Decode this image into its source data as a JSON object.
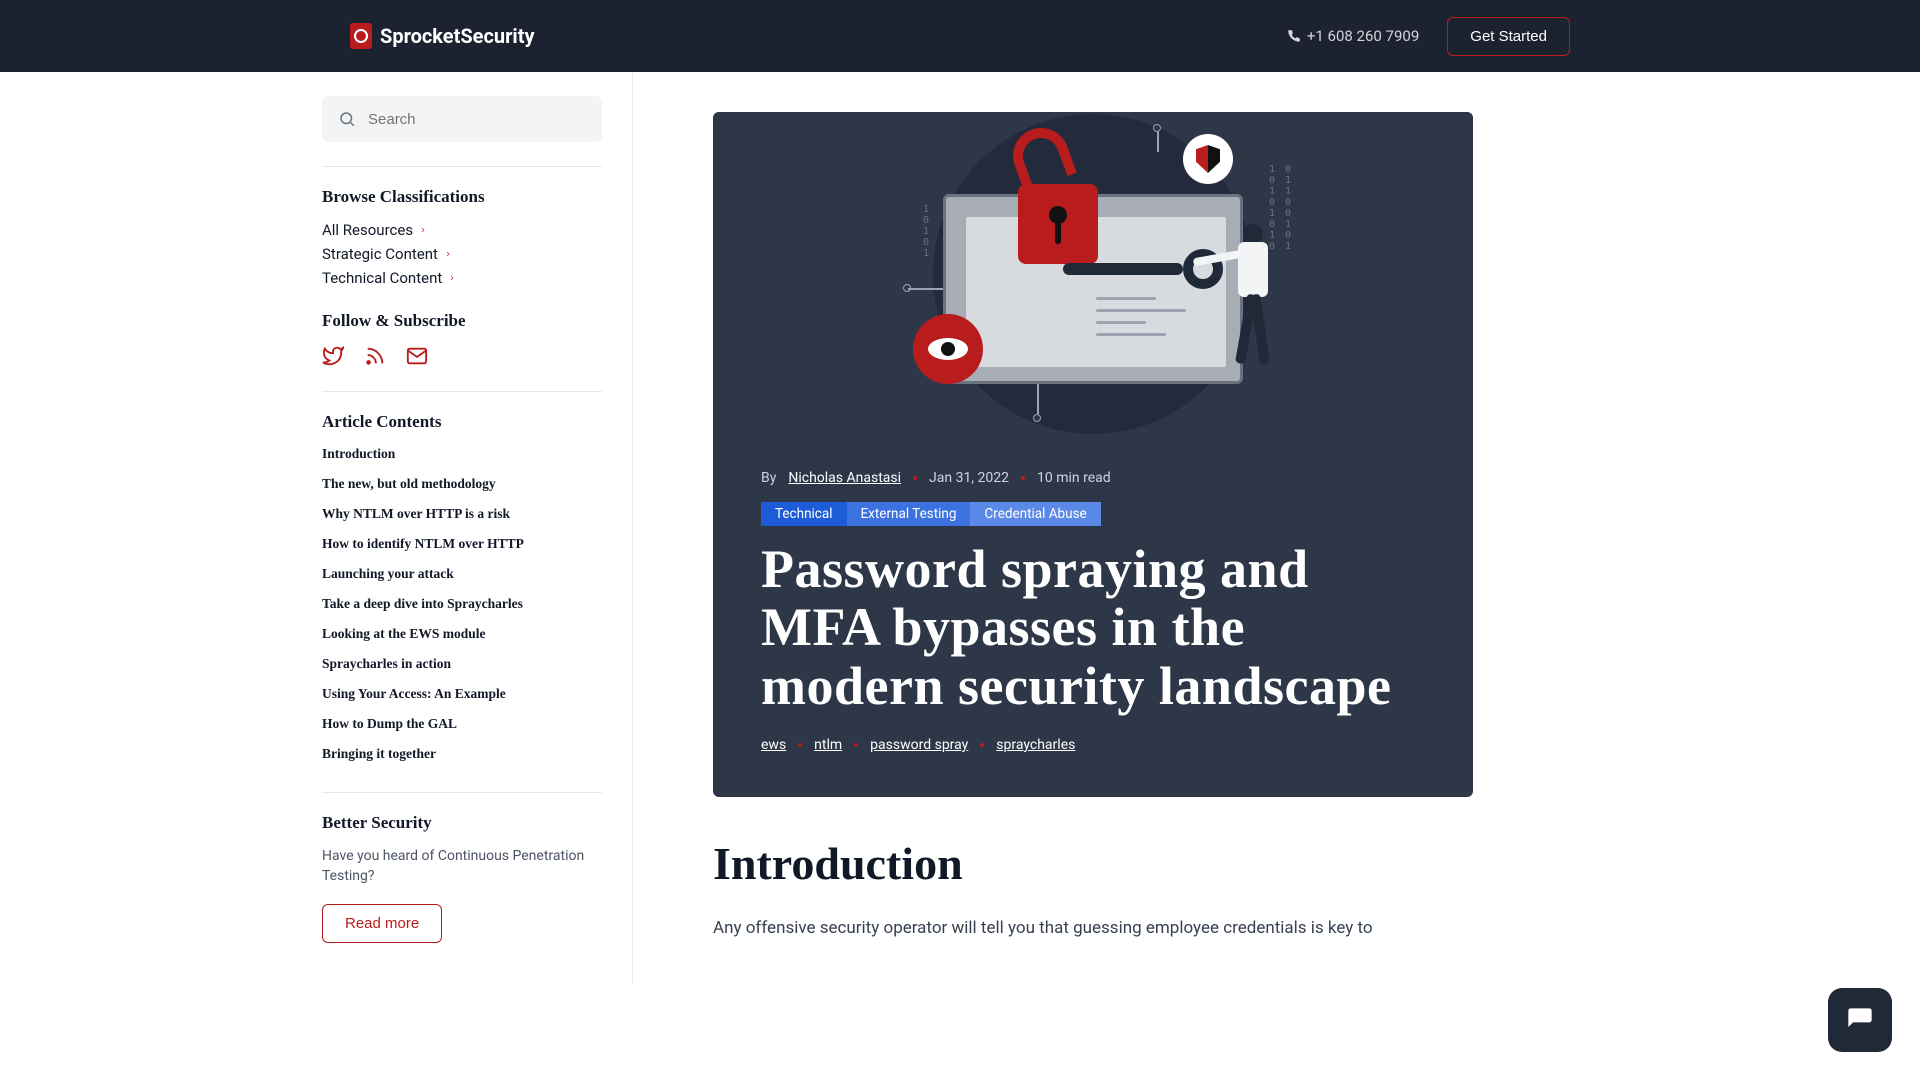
{
  "header": {
    "brand": "SprocketSecurity",
    "phone": "+1 608 260 7909",
    "cta": "Get Started"
  },
  "sidebar": {
    "search_placeholder": "Search",
    "browse_heading": "Browse Classifications",
    "classifications": [
      "All Resources",
      "Strategic Content",
      "Technical Content"
    ],
    "follow_heading": "Follow & Subscribe",
    "toc_heading": "Article Contents",
    "toc": [
      "Introduction",
      "The new, but old methodology",
      "Why NTLM over HTTP is a risk",
      "How to identify NTLM over HTTP",
      "Launching your attack",
      "Take a deep dive into Spraycharles",
      "Looking at the EWS module",
      "Spraycharles in action",
      "Using Your Access: An Example",
      "How to Dump the GAL",
      "Bringing it together"
    ],
    "better_heading": "Better Security",
    "better_text": "Have you heard of Continuous Penetration Testing?",
    "read_more": "Read more"
  },
  "article": {
    "by_label": "By",
    "author": "Nicholas Anastasi",
    "date": "Jan 31, 2022",
    "read_time": "10 min read",
    "categories": [
      "Technical",
      "External Testing",
      "Credential Abuse"
    ],
    "title": "Password spraying and MFA bypasses in the modern security landscape",
    "tags": [
      "ews",
      "ntlm",
      "password spray",
      "spraycharles"
    ],
    "intro_heading": "Introduction",
    "intro_para": "Any offensive security operator will tell you that guessing employee credentials is key to"
  }
}
